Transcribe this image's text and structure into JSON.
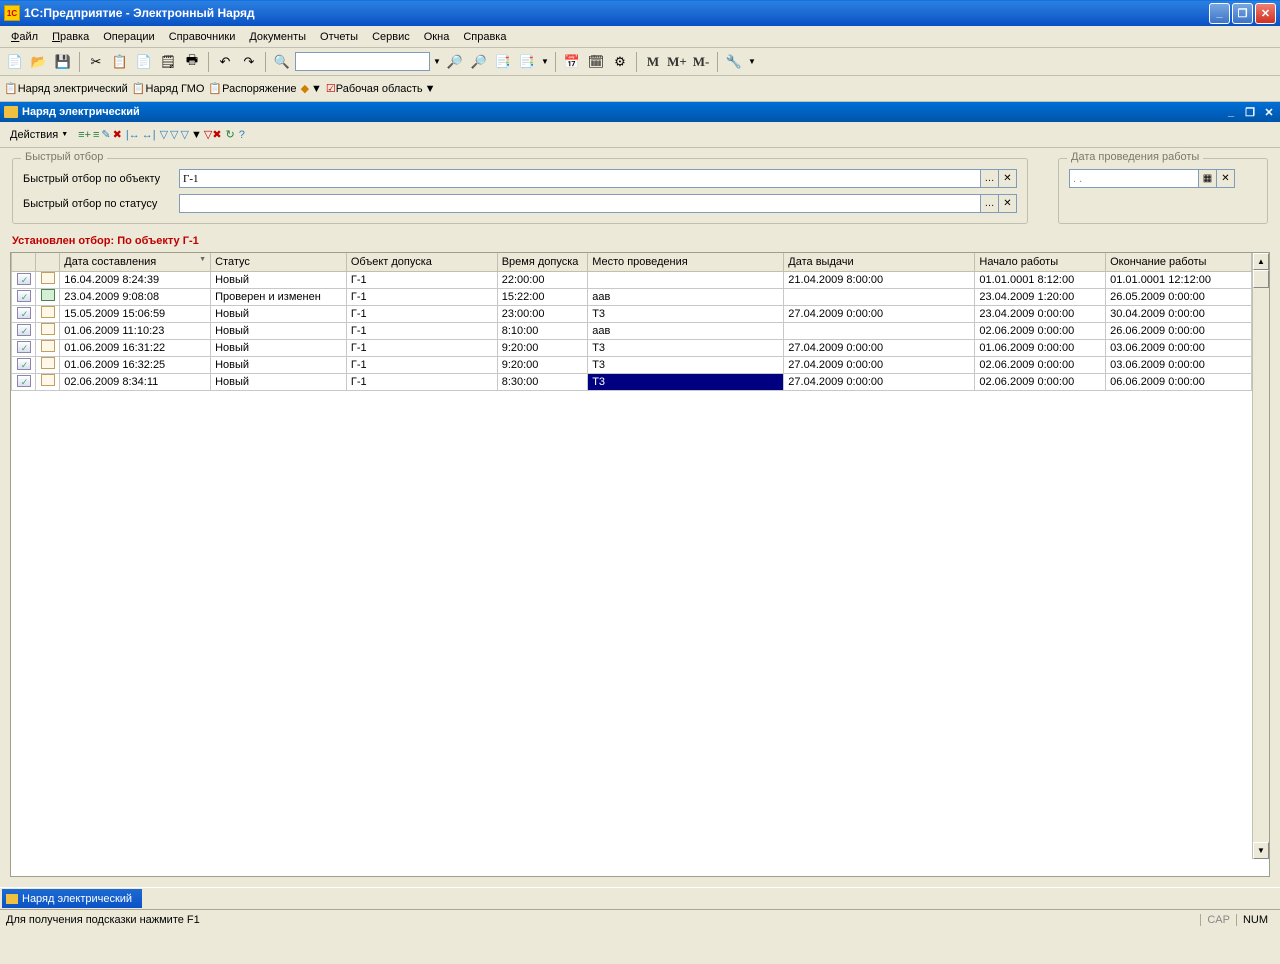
{
  "window": {
    "title": "1С:Предприятие  - Электронный Наряд"
  },
  "winControls": {
    "min": "_",
    "max": "❐",
    "close": "✕"
  },
  "menu": [
    "Файл",
    "Правка",
    "Операции",
    "Справочники",
    "Документы",
    "Отчеты",
    "Сервис",
    "Окна",
    "Справка"
  ],
  "menu_underline": [
    0,
    0,
    0,
    0,
    0,
    0,
    0,
    0,
    0
  ],
  "toolbar2": {
    "btn1": "Наряд электрический",
    "btn2": "Наряд ГМО",
    "btn3": "Распоряжение",
    "btn4": "Рабочая область"
  },
  "subwindow": {
    "title": "Наряд электрический"
  },
  "formToolbar": {
    "actions": "Действия"
  },
  "filter": {
    "legend": "Быстрый отбор",
    "byObjectLabel": "Быстрый отбор по объекту",
    "byObjectValue": "Г-1",
    "byStatusLabel": "Быстрый отбор по статусу",
    "byStatusValue": "",
    "dateLegend": "Дата проведения работы",
    "dateValue": " .  .",
    "statusLine": "Установлен отбор: По объекту Г-1"
  },
  "grid": {
    "columns": [
      "",
      "",
      "Дата составления",
      "Статус",
      "Объект допуска",
      "Время допуска",
      "Место проведения",
      "Дата выдачи",
      "Начало работы",
      "Окончание работы"
    ],
    "sortedCol": 2,
    "widths": [
      24,
      24,
      150,
      135,
      150,
      90,
      195,
      190,
      130,
      145
    ],
    "rows": [
      {
        "date": "16.04.2009 8:24:39",
        "status": "Новый",
        "obj": "Г-1",
        "time": "22:00:00",
        "place": "",
        "issue": "21.04.2009 8:00:00",
        "start": "01.01.0001 8:12:00",
        "end": "01.01.0001 12:12:00",
        "icon2": "page"
      },
      {
        "date": "23.04.2009 9:08:08",
        "status": "Проверен и изменен",
        "obj": "Г-1",
        "time": "15:22:00",
        "place": "аав",
        "issue": "",
        "start": "23.04.2009 1:20:00",
        "end": "26.05.2009 0:00:00",
        "icon2": "checked"
      },
      {
        "date": "15.05.2009 15:06:59",
        "status": "Новый",
        "obj": "Г-1",
        "time": "23:00:00",
        "place": "Т3",
        "issue": "27.04.2009 0:00:00",
        "start": "23.04.2009 0:00:00",
        "end": "30.04.2009 0:00:00",
        "icon2": "page"
      },
      {
        "date": "01.06.2009 11:10:23",
        "status": "Новый",
        "obj": "Г-1",
        "time": "8:10:00",
        "place": "аав",
        "issue": "",
        "start": "02.06.2009 0:00:00",
        "end": "26.06.2009 0:00:00",
        "icon2": "page"
      },
      {
        "date": "01.06.2009 16:31:22",
        "status": "Новый",
        "obj": "Г-1",
        "time": "9:20:00",
        "place": "Т3",
        "issue": "27.04.2009 0:00:00",
        "start": "01.06.2009 0:00:00",
        "end": "03.06.2009 0:00:00",
        "icon2": "page"
      },
      {
        "date": "01.06.2009 16:32:25",
        "status": "Новый",
        "obj": "Г-1",
        "time": "9:20:00",
        "place": "Т3",
        "issue": "27.04.2009 0:00:00",
        "start": "02.06.2009 0:00:00",
        "end": "03.06.2009 0:00:00",
        "icon2": "page"
      },
      {
        "date": "02.06.2009 8:34:11",
        "status": "Новый",
        "obj": "Г-1",
        "time": "8:30:00",
        "place": "Т3",
        "issue": "27.04.2009 0:00:00",
        "start": "02.06.2009 0:00:00",
        "end": "06.06.2009 0:00:00",
        "icon2": "page",
        "selectedCol": 6
      }
    ]
  },
  "taskbar": {
    "tab1": "Наряд электрический"
  },
  "statusbar": {
    "hint": "Для получения подсказки нажмите F1",
    "cap": "CAP",
    "num": "NUM"
  }
}
